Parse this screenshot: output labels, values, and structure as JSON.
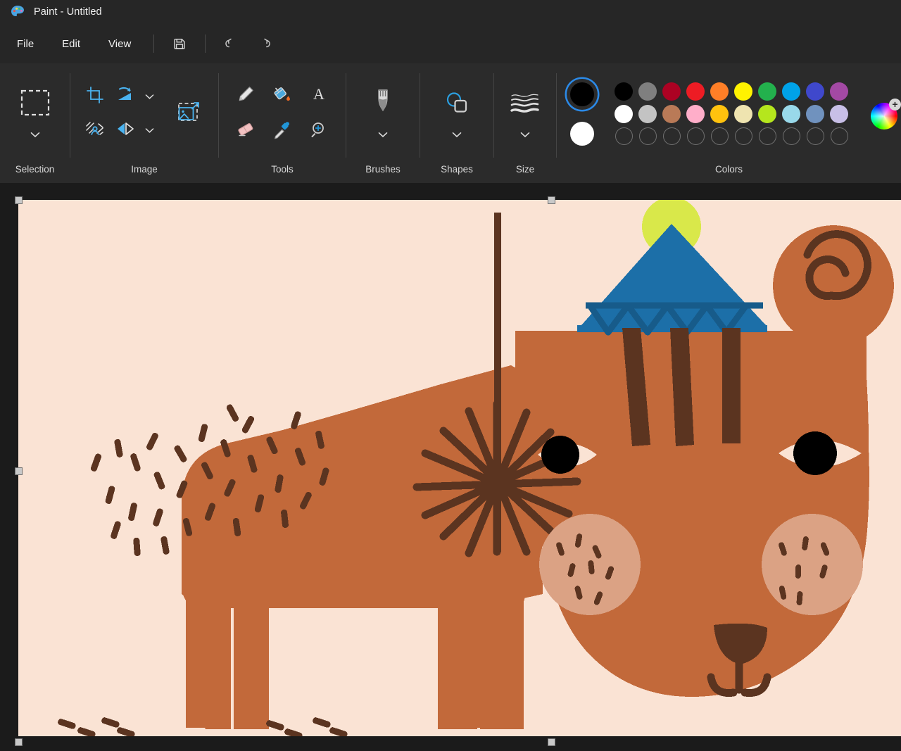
{
  "window": {
    "title": "Paint - Untitled",
    "app_icon": "paint-palette-icon"
  },
  "menubar": {
    "items": [
      {
        "label": "File",
        "name": "menu-file"
      },
      {
        "label": "Edit",
        "name": "menu-edit"
      },
      {
        "label": "View",
        "name": "menu-view"
      }
    ],
    "buttons": [
      {
        "name": "save-button",
        "icon": "floppy-disk-icon"
      },
      {
        "name": "undo-button",
        "icon": "undo-arrow-icon"
      },
      {
        "name": "redo-button",
        "icon": "redo-arrow-icon"
      }
    ]
  },
  "ribbon": {
    "groups": [
      {
        "label": "Selection",
        "name": "ribbon-group-selection"
      },
      {
        "label": "Image",
        "name": "ribbon-group-image"
      },
      {
        "label": "Tools",
        "name": "ribbon-group-tools"
      },
      {
        "label": "Brushes",
        "name": "ribbon-group-brushes"
      },
      {
        "label": "Shapes",
        "name": "ribbon-group-shapes"
      },
      {
        "label": "Size",
        "name": "ribbon-group-size"
      },
      {
        "label": "Colors",
        "name": "ribbon-group-colors"
      }
    ],
    "selection": {
      "tool": "rectangular-selection-icon",
      "expand": "chevron-down-icon"
    },
    "image_tools": [
      "crop-icon",
      "rotate-icon",
      "rotate-chevron-down-icon",
      "remove-background-icon",
      "flip-icon",
      "flip-chevron-down-icon",
      "resize-image-icon"
    ],
    "tools": [
      "pencil-icon",
      "fill-bucket-icon",
      "text-tool-icon",
      "eraser-icon",
      "color-picker-icon",
      "magnifier-icon"
    ],
    "brushes": {
      "icon": "brush-icon",
      "expand": "chevron-down-icon"
    },
    "shapes": {
      "icon": "shapes-icon",
      "expand": "chevron-down-icon"
    },
    "size": {
      "icon": "line-size-icon",
      "expand": "chevron-down-icon"
    }
  },
  "colors": {
    "primary": "#000000",
    "secondary": "#ffffff",
    "primary_selected": true,
    "row1": [
      "#000000",
      "#7f7f7f",
      "#ac0223",
      "#ed1c24",
      "#ff7f27",
      "#fff200",
      "#23b14d",
      "#00a2e8",
      "#3f48cc",
      "#a349a4"
    ],
    "row2": [
      "#ffffff",
      "#c3c3c3",
      "#b97a57",
      "#ffaec9",
      "#ffc20e",
      "#efe4b0",
      "#b5e61d",
      "#99d9ea",
      "#7092be",
      "#c8bfe7"
    ],
    "row3": [
      null,
      null,
      null,
      null,
      null,
      null,
      null,
      null,
      null,
      null
    ],
    "wheel": "color-wheel-icon",
    "wheel_add": "plus-icon"
  },
  "canvas": {
    "name": "drawing-canvas",
    "background": "#fae3d4",
    "artwork_title": "bear-drawing",
    "palette": {
      "fur": "#c2693a",
      "fur_dark": "#5b3420",
      "cheek": "#dba284",
      "hat": "#1c6fa8",
      "hat_dark": "#175b8a",
      "pompom": "#d9e84a",
      "eye": "#000000",
      "highlight": "#fae3d4"
    },
    "handles": [
      "top-left",
      "top-center",
      "middle-left",
      "bottom-left",
      "bottom-center"
    ]
  }
}
